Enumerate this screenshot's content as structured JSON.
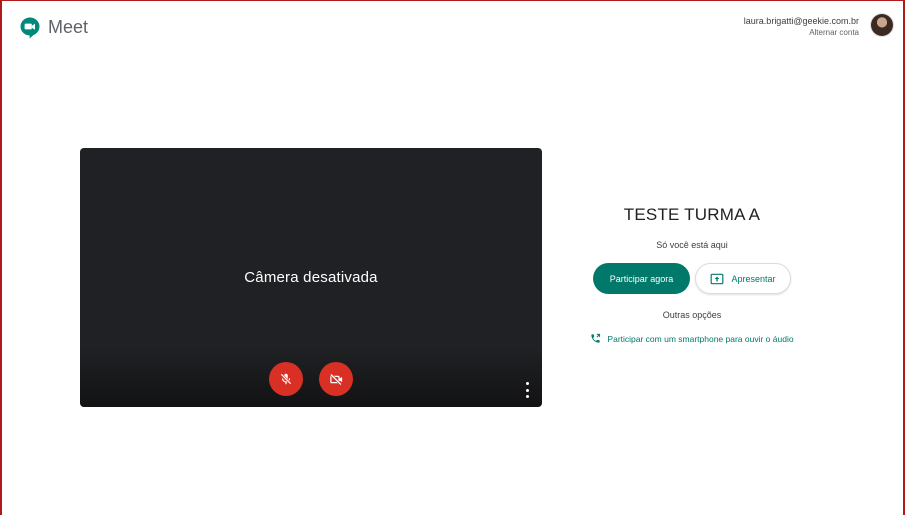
{
  "app": {
    "name": "Meet",
    "accent": "#00796b",
    "danger": "#d93025"
  },
  "account": {
    "email": "laura.brigatti@geekie.com.br",
    "switch_label": "Alternar conta",
    "avatar_icon": "user-avatar"
  },
  "preview": {
    "camera_off_text": "Câmera desativada",
    "mic_button_icon": "mic-off-icon",
    "camera_button_icon": "videocam-off-icon",
    "more_icon": "more-vert-icon"
  },
  "meeting": {
    "title": "TESTE TURMA A",
    "status": "Só você está aqui",
    "join_label": "Participar agora",
    "present_label": "Apresentar",
    "other_options_label": "Outras opções",
    "phone_join_label": "Participar com um smartphone para ouvir o áudio"
  }
}
